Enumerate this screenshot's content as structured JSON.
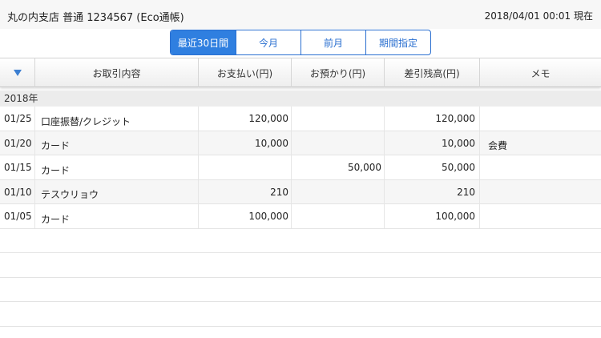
{
  "header": {
    "account": "丸の内支店 普通 1234567 (Eco通帳)",
    "as_of": "2018/04/01 00:01 現在"
  },
  "period_tabs": [
    {
      "label": "最近30日間",
      "active": true
    },
    {
      "label": "今月",
      "active": false
    },
    {
      "label": "前月",
      "active": false
    },
    {
      "label": "期間指定",
      "active": false
    }
  ],
  "table": {
    "sort_icon": "triangle-down-icon",
    "columns": [
      "お取引内容",
      "お支払い(円)",
      "お預かり(円)",
      "差引残高(円)",
      "メモ"
    ],
    "year": "2018年",
    "rows": [
      {
        "date": "01/25",
        "desc": "口座振替/クレジット",
        "payment": "120,000",
        "deposit": "",
        "balance": "120,000",
        "memo": ""
      },
      {
        "date": "01/20",
        "desc": "カード",
        "payment": "10,000",
        "deposit": "",
        "balance": "10,000",
        "memo": "会費"
      },
      {
        "date": "01/15",
        "desc": "カード",
        "payment": "",
        "deposit": "50,000",
        "balance": "50,000",
        "memo": ""
      },
      {
        "date": "01/10",
        "desc": "テスウリョウ",
        "payment": "210",
        "deposit": "",
        "balance": "210",
        "memo": ""
      },
      {
        "date": "01/05",
        "desc": "カード",
        "payment": "100,000",
        "deposit": "",
        "balance": "100,000",
        "memo": ""
      }
    ]
  },
  "colors": {
    "accent": "#2f7fe0",
    "sort_icon": "#3c7fd1",
    "year_band": "#ececec"
  }
}
